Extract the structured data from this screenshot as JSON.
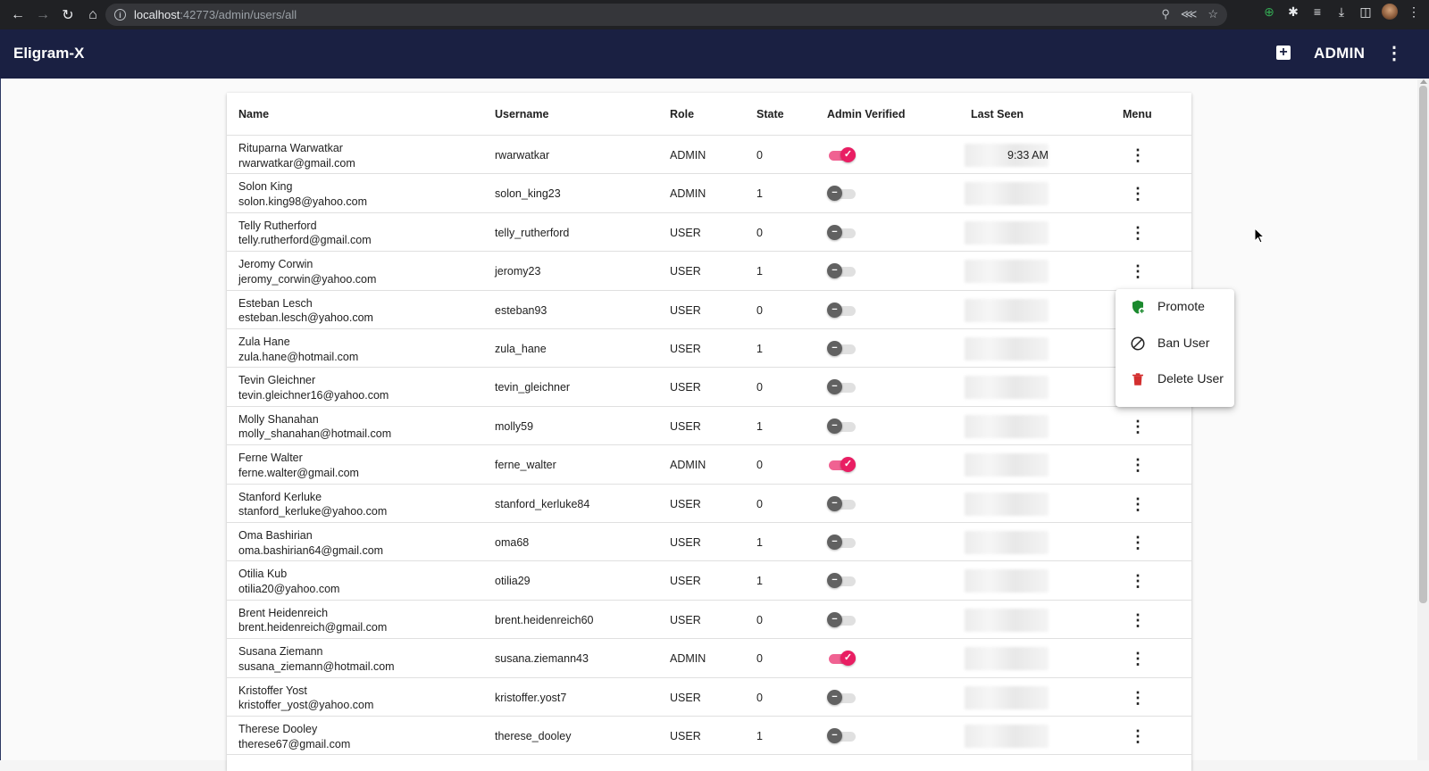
{
  "browser": {
    "url_host": "localhost",
    "url_path": ":42773/admin/users/all"
  },
  "app": {
    "title": "Eligram-X",
    "user_label": "ADMIN"
  },
  "table": {
    "headers": {
      "name": "Name",
      "username": "Username",
      "role": "Role",
      "state": "State",
      "admin_verified": "Admin Verified",
      "last_seen": "Last Seen",
      "menu": "Menu"
    },
    "rows": [
      {
        "name": "Rituparna Warwatkar",
        "email": "rwarwatkar@gmail.com",
        "username": "rwarwatkar",
        "role": "ADMIN",
        "state": "0",
        "verified": true,
        "last_seen": "9:33 AM"
      },
      {
        "name": "Solon King",
        "email": "solon.king98@yahoo.com",
        "username": "solon_king23",
        "role": "ADMIN",
        "state": "1",
        "verified": false,
        "last_seen": ""
      },
      {
        "name": "Telly Rutherford",
        "email": "telly.rutherford@gmail.com",
        "username": "telly_rutherford",
        "role": "USER",
        "state": "0",
        "verified": false,
        "last_seen": ""
      },
      {
        "name": "Jeromy Corwin",
        "email": "jeromy_corwin@yahoo.com",
        "username": "jeromy23",
        "role": "USER",
        "state": "1",
        "verified": false,
        "last_seen": ""
      },
      {
        "name": "Esteban Lesch",
        "email": "esteban.lesch@yahoo.com",
        "username": "esteban93",
        "role": "USER",
        "state": "0",
        "verified": false,
        "last_seen": ""
      },
      {
        "name": "Zula Hane",
        "email": "zula.hane@hotmail.com",
        "username": "zula_hane",
        "role": "USER",
        "state": "1",
        "verified": false,
        "last_seen": ""
      },
      {
        "name": "Tevin Gleichner",
        "email": "tevin.gleichner16@yahoo.com",
        "username": "tevin_gleichner",
        "role": "USER",
        "state": "0",
        "verified": false,
        "last_seen": ""
      },
      {
        "name": "Molly Shanahan",
        "email": "molly_shanahan@hotmail.com",
        "username": "molly59",
        "role": "USER",
        "state": "1",
        "verified": false,
        "last_seen": ""
      },
      {
        "name": "Ferne Walter",
        "email": "ferne.walter@gmail.com",
        "username": "ferne_walter",
        "role": "ADMIN",
        "state": "0",
        "verified": true,
        "last_seen": ""
      },
      {
        "name": "Stanford Kerluke",
        "email": "stanford_kerluke@yahoo.com",
        "username": "stanford_kerluke84",
        "role": "USER",
        "state": "0",
        "verified": false,
        "last_seen": ""
      },
      {
        "name": "Oma Bashirian",
        "email": "oma.bashirian64@gmail.com",
        "username": "oma68",
        "role": "USER",
        "state": "1",
        "verified": false,
        "last_seen": ""
      },
      {
        "name": "Otilia Kub",
        "email": "otilia20@yahoo.com",
        "username": "otilia29",
        "role": "USER",
        "state": "1",
        "verified": false,
        "last_seen": ""
      },
      {
        "name": "Brent Heidenreich",
        "email": "brent.heidenreich@gmail.com",
        "username": "brent.heidenreich60",
        "role": "USER",
        "state": "0",
        "verified": false,
        "last_seen": ""
      },
      {
        "name": "Susana Ziemann",
        "email": "susana_ziemann@hotmail.com",
        "username": "susana.ziemann43",
        "role": "ADMIN",
        "state": "0",
        "verified": true,
        "last_seen": ""
      },
      {
        "name": "Kristoffer Yost",
        "email": "kristoffer_yost@yahoo.com",
        "username": "kristoffer.yost7",
        "role": "USER",
        "state": "0",
        "verified": false,
        "last_seen": ""
      },
      {
        "name": "Therese Dooley",
        "email": "therese67@gmail.com",
        "username": "therese_dooley",
        "role": "USER",
        "state": "1",
        "verified": false,
        "last_seen": ""
      }
    ]
  },
  "context_menu": {
    "promote": "Promote",
    "ban": "Ban User",
    "delete": "Delete User"
  },
  "colors": {
    "app_bar": "#1a2042",
    "toggle_on": "#e91e63",
    "promote_icon": "#1b8a2e",
    "delete_icon": "#d32f2f"
  },
  "icons": {
    "promote": "shield-add-icon",
    "ban": "block-icon",
    "delete": "trash-icon",
    "add": "add-box-icon",
    "more": "more-vert-icon"
  }
}
